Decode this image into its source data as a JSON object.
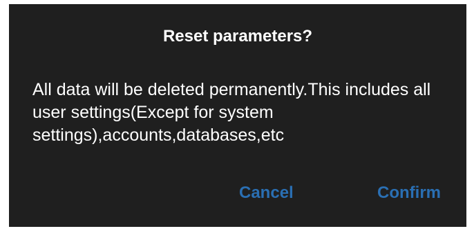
{
  "dialog": {
    "title": "Reset parameters?",
    "message": "All data will be deleted permanently.This includes all user settings(Except for system settings),accounts,databases,etc",
    "buttons": {
      "cancel_label": "Cancel",
      "confirm_label": "Confirm"
    },
    "colors": {
      "background": "#1f1f1f",
      "text": "#ffffff",
      "accent": "#2a6fb3"
    }
  }
}
